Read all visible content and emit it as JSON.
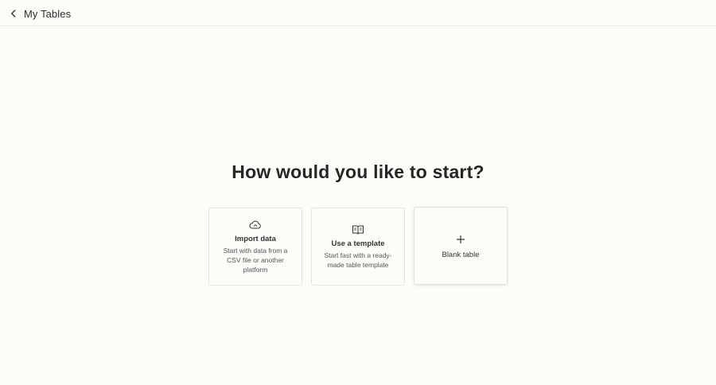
{
  "header": {
    "back_label": "My Tables"
  },
  "main": {
    "heading": "How would you like to start?",
    "options": [
      {
        "title": "Import data",
        "description": "Start with data from a CSV file or another platform",
        "icon": "cloud-icon"
      },
      {
        "title": "Use a template",
        "description": "Start fast with a ready-made table template",
        "icon": "book-icon"
      },
      {
        "title": "Blank table",
        "description": "",
        "icon": "plus-icon"
      }
    ]
  },
  "colors": {
    "background": "#fdfcf8",
    "text": "#2b2b2b",
    "border": "#e6e4dc"
  }
}
